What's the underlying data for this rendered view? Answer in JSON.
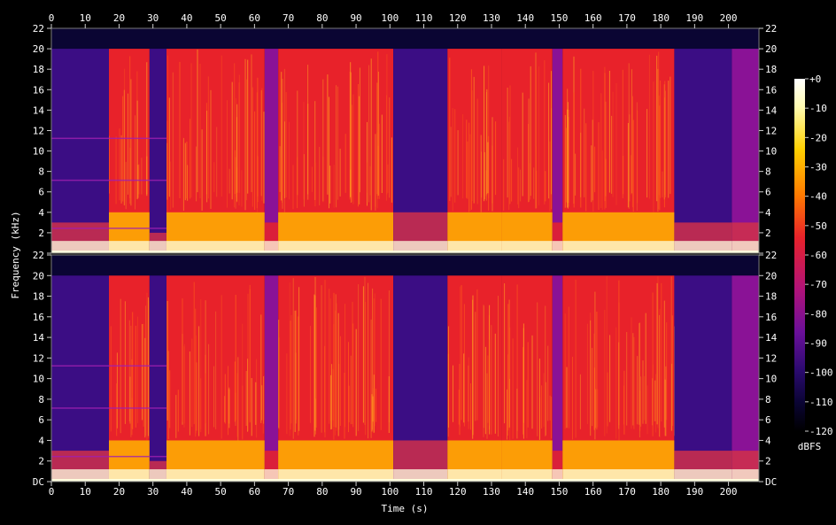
{
  "chart_data": {
    "type": "heatmap",
    "title": "",
    "xlabel": "Time (s)",
    "ylabel": "Frequency (kHz)",
    "xlim": [
      0,
      209
    ],
    "ylim": [
      0,
      22
    ],
    "x_ticks": [
      "0",
      "10",
      "20",
      "30",
      "40",
      "50",
      "60",
      "70",
      "80",
      "90",
      "100",
      "110",
      "120",
      "130",
      "140",
      "150",
      "160",
      "170",
      "180",
      "190",
      "200"
    ],
    "y_ticks": [
      "DC",
      "2",
      "4",
      "6",
      "8",
      "10",
      "12",
      "14",
      "16",
      "18",
      "20",
      "22"
    ],
    "channels": [
      "Channel 1 (top)",
      "Channel 2 (bottom)"
    ],
    "colorbar": {
      "label": "dBFS",
      "ticks": [
        "+0",
        "-10",
        "-20",
        "-30",
        "-40",
        "-50",
        "-60",
        "-70",
        "-80",
        "-90",
        "-100",
        "-110",
        "-120"
      ],
      "range": [
        -120,
        0
      ]
    },
    "segments": [
      {
        "start": 0,
        "end": 17,
        "cutoff_khz": 20,
        "level": "quiet",
        "low_band_khz": 3
      },
      {
        "start": 17,
        "end": 29,
        "cutoff_khz": 20,
        "level": "loud",
        "low_band_khz": 4
      },
      {
        "start": 29,
        "end": 34,
        "cutoff_khz": 20,
        "level": "quiet",
        "low_band_khz": 2
      },
      {
        "start": 34,
        "end": 63,
        "cutoff_khz": 20,
        "level": "loud",
        "low_band_khz": 4
      },
      {
        "start": 63,
        "end": 67,
        "cutoff_khz": 20,
        "level": "medium",
        "low_band_khz": 3
      },
      {
        "start": 67,
        "end": 101,
        "cutoff_khz": 20,
        "level": "loud",
        "low_band_khz": 4
      },
      {
        "start": 101,
        "end": 117,
        "cutoff_khz": 20,
        "level": "quiet",
        "low_band_khz": 4
      },
      {
        "start": 117,
        "end": 133,
        "cutoff_khz": 20,
        "level": "loud",
        "low_band_khz": 4
      },
      {
        "start": 133,
        "end": 148,
        "cutoff_khz": 20,
        "level": "loud",
        "low_band_khz": 4
      },
      {
        "start": 148,
        "end": 151,
        "cutoff_khz": 20,
        "level": "medium",
        "low_band_khz": 3
      },
      {
        "start": 151,
        "end": 184,
        "cutoff_khz": 20,
        "level": "loud",
        "low_band_khz": 4
      },
      {
        "start": 184,
        "end": 201,
        "cutoff_khz": 20,
        "level": "quiet",
        "low_band_khz": 3
      },
      {
        "start": 201,
        "end": 209,
        "cutoff_khz": 20,
        "level": "fade",
        "low_band_khz": 3
      }
    ],
    "colors": {
      "background": "#000000",
      "plot_floor": "#0a0533",
      "quiet": "#3b0d84",
      "medium": "#8a1296",
      "loud": "#e8222a",
      "hot": "#ffb300",
      "peak": "#ffffe0"
    }
  }
}
